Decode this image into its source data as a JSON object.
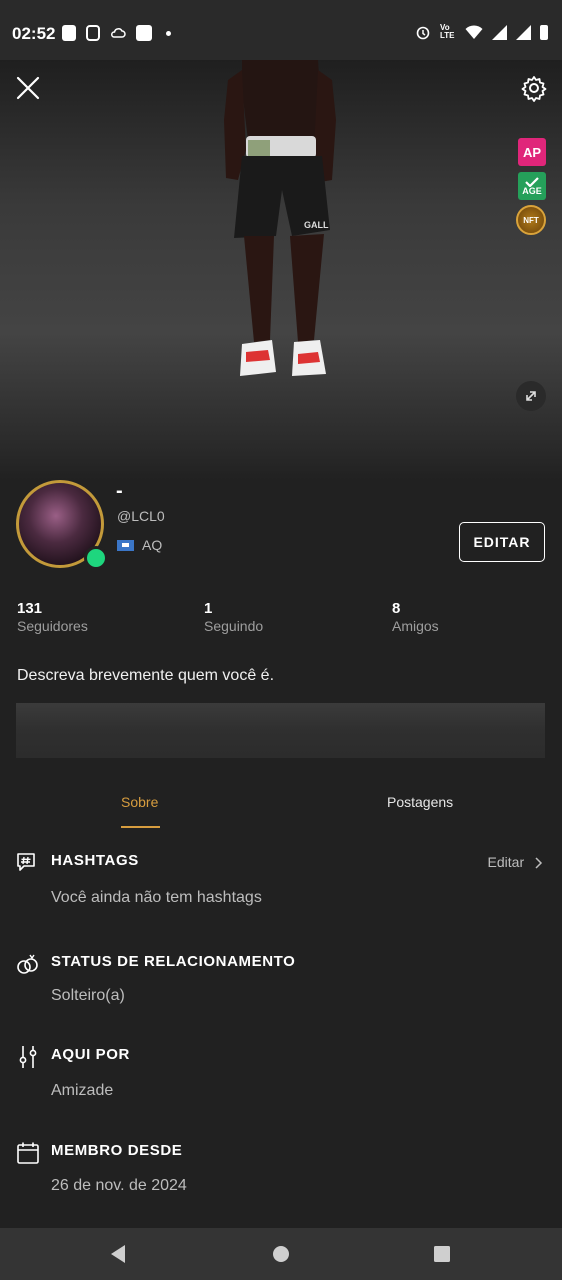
{
  "status_bar": {
    "time": "02:52",
    "left_icons": [
      "alert-icon",
      "clipboard-icon",
      "cloud-icon",
      "square-icon",
      "dot-icon"
    ],
    "right_icons": [
      "alarm-icon",
      "volte-icon",
      "wifi-icon",
      "signal-icon",
      "battery-icon"
    ],
    "volte_label": "Vo LTE"
  },
  "hero": {
    "badges": {
      "ap": "AP",
      "age": "AGE",
      "nft": "NFT"
    }
  },
  "profile": {
    "display_name": "-",
    "username": "@LCL0",
    "location": "AQ",
    "edit_label": "EDITAR"
  },
  "stats": [
    {
      "value": "131",
      "label": "Seguidores"
    },
    {
      "value": "1",
      "label": "Seguindo"
    },
    {
      "value": "8",
      "label": "Amigos"
    }
  ],
  "bio_placeholder": "Descreva brevemente quem você é.",
  "tabs": {
    "about": "Sobre",
    "posts": "Postagens"
  },
  "sections": {
    "hashtags": {
      "title": "HASHTAGS",
      "edit": "Editar",
      "value": "Você ainda não tem hashtags"
    },
    "relationship": {
      "title": "STATUS DE RELACIONAMENTO",
      "value": "Solteiro(a)"
    },
    "here_for": {
      "title": "AQUI POR",
      "value": "Amizade"
    },
    "member_since": {
      "title": "MEMBRO DESDE",
      "value": "26 de nov. de 2024"
    }
  },
  "colors": {
    "accent": "#d79d3f",
    "online": "#1ed67e",
    "background": "#212121"
  }
}
